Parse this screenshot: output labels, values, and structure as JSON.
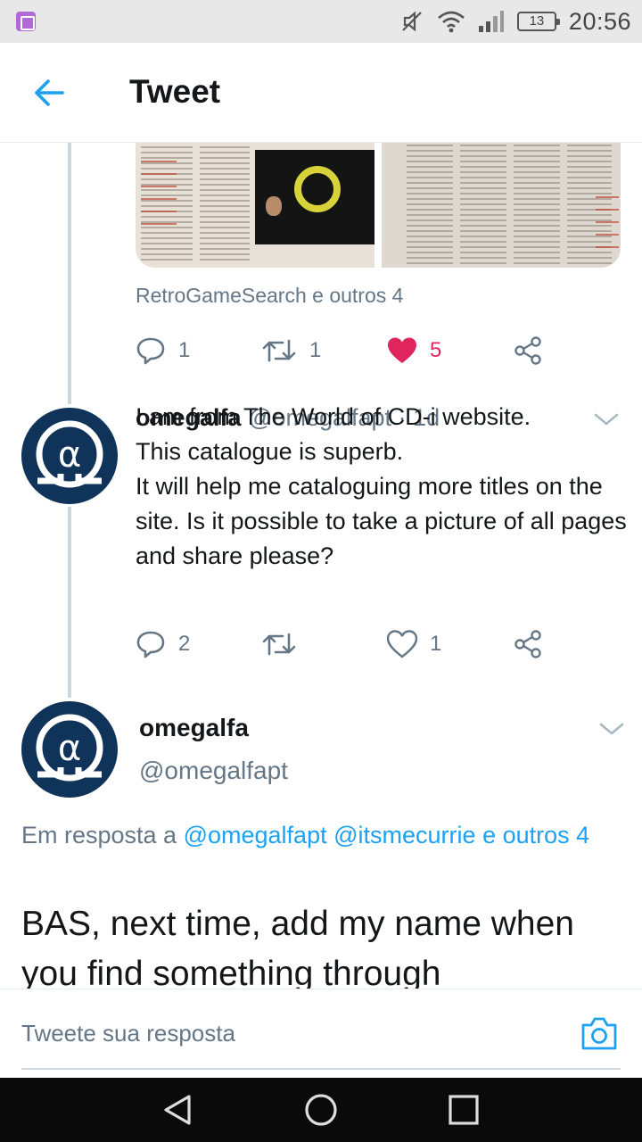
{
  "status_bar": {
    "battery": "13",
    "time": "20:56",
    "icons": [
      "gallery-icon",
      "mute-icon",
      "wifi-icon",
      "signal-icon",
      "battery-icon"
    ]
  },
  "header": {
    "title": "Tweet",
    "back_icon": "arrow-left-icon"
  },
  "prev_tweet": {
    "liked_by": "RetroGameSearch e outros 4",
    "replies": "1",
    "retweets": "1",
    "likes": "5",
    "liked": true
  },
  "reply_tweet": {
    "name": "omegalfa",
    "handle": "@omegalfapt",
    "time": "· 1d",
    "text": "I am from The World of CD-i website.\nThis catalogue is superb.\nIt will help me cataloguing more titles on the site. Is it possible to take a picture of all pages and share please?",
    "replies": "2",
    "retweets": "",
    "likes": "1"
  },
  "focus_tweet": {
    "name": "omegalfa",
    "handle": "@omegalfapt",
    "reply_prefix": "Em resposta a",
    "mention_1": "@omegalfapt",
    "mention_2": "@itsmecurrie",
    "mention_more": "e outros 4",
    "text": "BAS, next time, add my name when you find something through"
  },
  "composer": {
    "placeholder": "Tweete sua resposta"
  },
  "colors": {
    "accent": "#1da1f2",
    "like": "#e0245e",
    "secondary_text": "#657786",
    "avatar_bg": "#0f3359"
  }
}
